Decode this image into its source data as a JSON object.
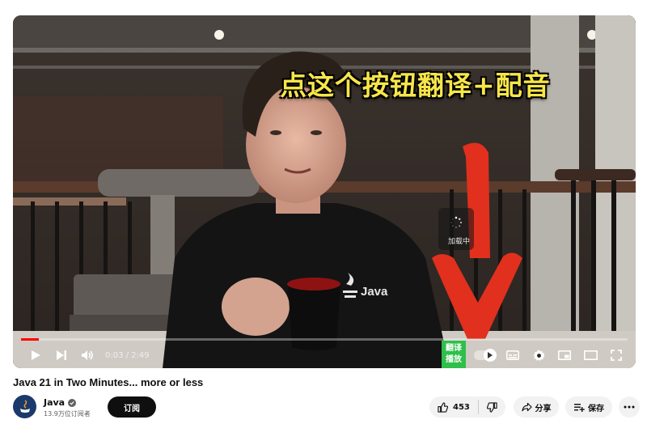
{
  "player": {
    "overlay_caption": "点这个按钮翻译+配音",
    "loading_text": "加载中",
    "shirt_text": "Java",
    "progress_fraction": 0.029,
    "time_current": "0:03",
    "time_total": "2:49",
    "time_display": "0:03 / 2:49",
    "translate_button": {
      "line1": "翻译",
      "line2": "播放"
    },
    "controls": [
      "play-icon",
      "next-icon",
      "volume-icon",
      "autoplay-toggle",
      "subtitles-icon",
      "settings-icon",
      "miniplayer-icon",
      "theater-icon",
      "fullscreen-icon"
    ],
    "colors": {
      "progress": "#ff0000",
      "translate_button": "#2fbf4a",
      "caption": "#f7e64a"
    }
  },
  "video": {
    "title": "Java 21 in Two Minutes... more or less"
  },
  "channel": {
    "name": "Java",
    "subscribers": "13.9万位订阅者",
    "subscribe_label": "订阅"
  },
  "actions": {
    "like_count": "453",
    "share_label": "分享",
    "save_label": "保存"
  }
}
